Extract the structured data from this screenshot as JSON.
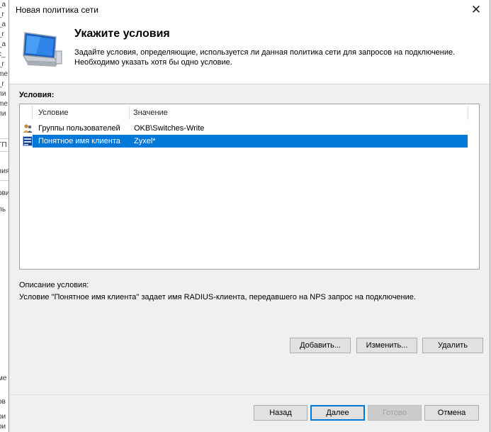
{
  "background_window": {
    "fragments": [
      "_a",
      "_r",
      "_a",
      "_r",
      "_a",
      "c_",
      "_r",
      "me",
      "_r",
      "ли",
      "me",
      "ли",
      "ГП",
      "вия",
      "ови",
      "ль",
      "ме",
      "ов",
      "ри",
      "ри"
    ]
  },
  "dialog": {
    "title": "Новая политика сети",
    "close_label": "✕"
  },
  "header": {
    "title": "Укажите условия",
    "description_line1": "Задайте условия, определяющие, используется ли данная политика сети для запросов на подключение.",
    "description_line2": "Необходимо указать хотя бы одно условие."
  },
  "conditions": {
    "label": "Условия:",
    "columns": [
      "Условие",
      "Значение"
    ],
    "rows": [
      {
        "condition": "Группы пользователей",
        "value": "OKB\\Switches-Write",
        "icon": "user-group-icon",
        "selected": false
      },
      {
        "condition": "Понятное имя клиента",
        "value": "Zyxel*",
        "icon": "client-icon",
        "selected": true
      }
    ]
  },
  "description": {
    "label": "Описание условия:",
    "text": "Условие \"Понятное имя клиента\" задает имя RADIUS-клиента, передавшего на NPS запрос на подключение."
  },
  "actions": {
    "add": "Добавить...",
    "edit": "Изменить...",
    "remove": "Удалить"
  },
  "footer": {
    "back": "Назад",
    "next": "Далее",
    "finish": "Готово",
    "cancel": "Отмена"
  }
}
